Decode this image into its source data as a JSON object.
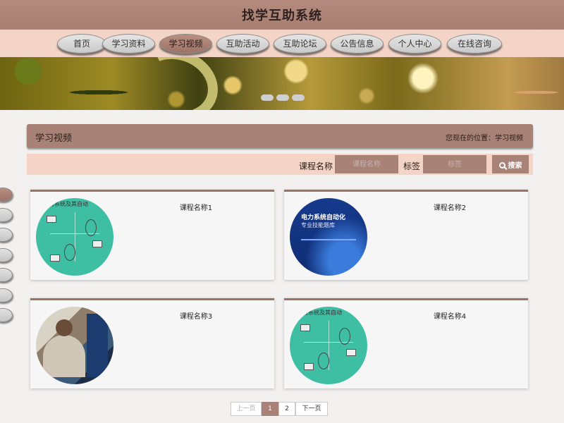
{
  "header": {
    "title": "找学互助系统"
  },
  "nav": {
    "items": [
      {
        "label": "首页"
      },
      {
        "label": "学习资料"
      },
      {
        "label": "学习视频",
        "active": true
      },
      {
        "label": "互助活动"
      },
      {
        "label": "互助论坛"
      },
      {
        "label": "公告信息"
      },
      {
        "label": "个人中心"
      },
      {
        "label": "在线咨询"
      }
    ]
  },
  "section": {
    "title": "学习视频",
    "breadcrumb": "您现在的位置：学习视频"
  },
  "search": {
    "course_label": "课程名称",
    "course_placeholder": "课程名称",
    "tag_label": "标签",
    "tag_placeholder": "标签",
    "button_label": "搜索"
  },
  "cards": [
    {
      "name": "课程名称1",
      "thumb_text": "电力系统及其自动"
    },
    {
      "name": "课程名称2",
      "thumb_title": "电力系统自动化",
      "thumb_subtitle": "专业技能题库"
    },
    {
      "name": "课程名称3"
    },
    {
      "name": "课程名称4",
      "thumb_text": "电力系统及其自动"
    }
  ],
  "pagination": {
    "prev": "上一页",
    "pages": [
      "1",
      "2"
    ],
    "current": "1",
    "next": "下一页"
  },
  "colors": {
    "accent": "#a88276",
    "nav_bg": "#f3d4c6",
    "diagram_teal": "#3ebfa3"
  }
}
